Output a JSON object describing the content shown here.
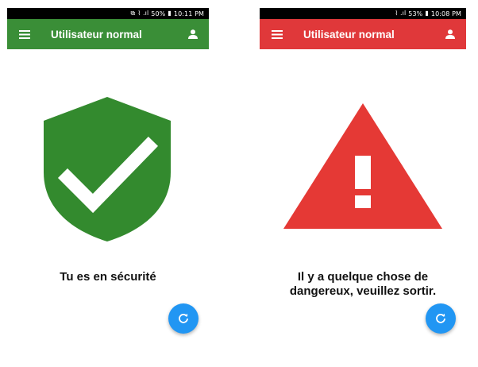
{
  "screens": [
    {
      "status": {
        "cast": "⧉",
        "signal": "⌇ .ıl",
        "battery": "50%",
        "time": "10:11 PM"
      },
      "appbar": {
        "title": "Utilisateur normal",
        "color": "#3a8e37"
      },
      "hero": {
        "icon": "shield-check-icon",
        "color": "#338a2e"
      },
      "message": "Tu es en sécurité",
      "fab": {
        "icon": "refresh-icon",
        "color": "#2196f3"
      }
    },
    {
      "status": {
        "signal": "⌇ .ıl",
        "battery": "53%",
        "time": "10:08 PM"
      },
      "appbar": {
        "title": "Utilisateur normal",
        "color": "#e0383a"
      },
      "hero": {
        "icon": "warning-triangle-icon",
        "color": "#e53935"
      },
      "message": "Il y a quelque chose de dangereux, veuillez sortir.",
      "fab": {
        "icon": "refresh-icon",
        "color": "#2196f3"
      }
    }
  ]
}
